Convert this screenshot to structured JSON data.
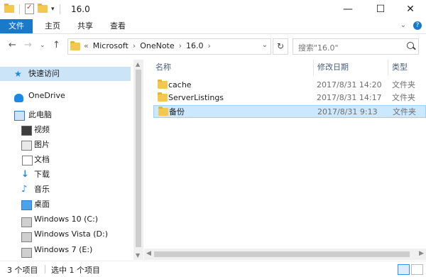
{
  "window": {
    "title": "16.0"
  },
  "ribbon": {
    "tabs": [
      {
        "label": "文件",
        "active": true
      },
      {
        "label": "主页"
      },
      {
        "label": "共享"
      },
      {
        "label": "查看"
      }
    ]
  },
  "address": {
    "prefix": "«",
    "segments": [
      "Microsoft",
      "OneNote",
      "16.0"
    ],
    "separator": "›"
  },
  "search": {
    "placeholder": "搜索\"16.0\""
  },
  "nav": {
    "items": [
      {
        "label": "快速访问",
        "icon": "star-icon",
        "selected": true
      },
      {
        "label": "OneDrive",
        "icon": "onedrive-icon"
      },
      {
        "label": "此电脑",
        "icon": "computer-icon"
      },
      {
        "label": "视频",
        "icon": "video-icon"
      },
      {
        "label": "图片",
        "icon": "pictures-icon"
      },
      {
        "label": "文档",
        "icon": "documents-icon"
      },
      {
        "label": "下载",
        "icon": "download-icon"
      },
      {
        "label": "音乐",
        "icon": "music-icon"
      },
      {
        "label": "桌面",
        "icon": "desktop-icon"
      },
      {
        "label": "Windows 10 (C:)",
        "icon": "drive-icon"
      },
      {
        "label": "Windows Vista (D:)",
        "icon": "drive-icon"
      },
      {
        "label": "Windows 7 (E:)",
        "icon": "drive-icon"
      }
    ]
  },
  "columns": {
    "name": "名称",
    "date": "修改日期",
    "type": "类型"
  },
  "files": [
    {
      "name": "cache",
      "date": "2017/8/31 14:20",
      "type": "文件夹",
      "selected": false
    },
    {
      "name": "ServerListings",
      "date": "2017/8/31 14:17",
      "type": "文件夹",
      "selected": false
    },
    {
      "name": "备份",
      "date": "2017/8/31 9:13",
      "type": "文件夹",
      "selected": true
    }
  ],
  "status": {
    "count": "3 个项目",
    "selection": "选中 1 个项目"
  },
  "colors": {
    "accent": "#1979ca",
    "selection": "#cce8ff",
    "folder": "#f2c94c"
  }
}
